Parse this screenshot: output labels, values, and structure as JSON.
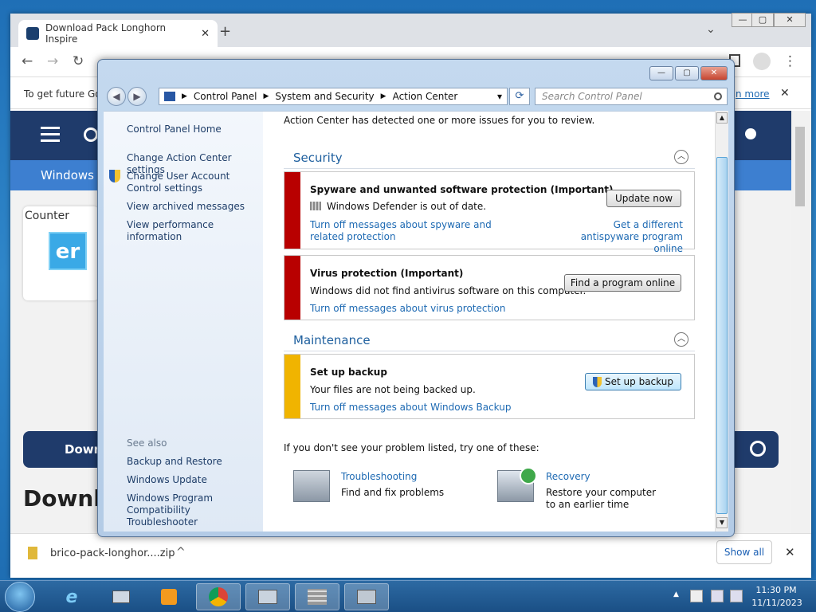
{
  "browser": {
    "tab_title": "Download Pack Longhorn Inspire",
    "tab_close": "✕",
    "new_tab": "+",
    "tabs_menu": "⌄",
    "win_min": "—",
    "win_max": "▢",
    "win_close": "✕",
    "back": "←",
    "forward": "→",
    "reload": "↻",
    "menu": "⋮",
    "info_text": "To get future Go",
    "info_link": "n more",
    "info_close": "✕"
  },
  "website": {
    "nav_label": "Windows",
    "counter_alt": "Counter",
    "logo_text": "er",
    "download_label": "Down",
    "heading": "Downlo"
  },
  "downloads": {
    "file_name": "brico-pack-longhor....zip",
    "chevron": "^",
    "show_all": "Show all",
    "close": "✕"
  },
  "dialog": {
    "min": "—",
    "max": "▢",
    "close": "✕",
    "back": "◀",
    "forward": "▶",
    "breadcrumb": [
      "Control Panel",
      "System and Security",
      "Action Center"
    ],
    "separator": "▶",
    "dropdown": "▾",
    "refresh": "⟳",
    "search_placeholder": "Search Control Panel",
    "left_links": {
      "home": "Control Panel Home",
      "settings": "Change Action Center settings",
      "uac": "Change User Account Control settings",
      "archived": "View archived messages",
      "performance": "View performance information"
    },
    "see_also": {
      "label": "See also",
      "backup": "Backup and Restore",
      "update": "Windows Update",
      "compat": "Windows Program Compatibility Troubleshooter"
    },
    "intro": "Action Center has detected one or more issues for you to review.",
    "security": {
      "heading": "Security",
      "spyware_title": "Spyware and unwanted software protection  (Important)",
      "spyware_text": "Windows Defender is out of date.",
      "spyware_btn": "Update now",
      "spyware_off": "Turn off messages about spyware and related protection",
      "spyware_alt": "Get a different antispyware program online",
      "virus_title": "Virus protection  (Important)",
      "virus_text": "Windows did not find antivirus software on this computer.",
      "virus_btn": "Find a program online",
      "virus_off": "Turn off messages about virus protection"
    },
    "maintenance": {
      "heading": "Maintenance",
      "backup_title": "Set up backup",
      "backup_text": "Your files are not being backed up.",
      "backup_btn": "Set up backup",
      "backup_off": "Turn off messages about Windows Backup"
    },
    "footer": {
      "prompt": "If you don't see your problem listed, try one of these:",
      "troubleshoot_link": "Troubleshooting",
      "troubleshoot_desc": "Find and fix problems",
      "recovery_link": "Recovery",
      "recovery_desc": "Restore your computer to an earlier time"
    }
  },
  "taskbar": {
    "time": "11:30 PM",
    "date": "11/11/2023",
    "tray_arrow": "▲"
  },
  "colors": {
    "critical": "#b80000",
    "warning": "#f0b400",
    "link": "#1e6ab3"
  }
}
